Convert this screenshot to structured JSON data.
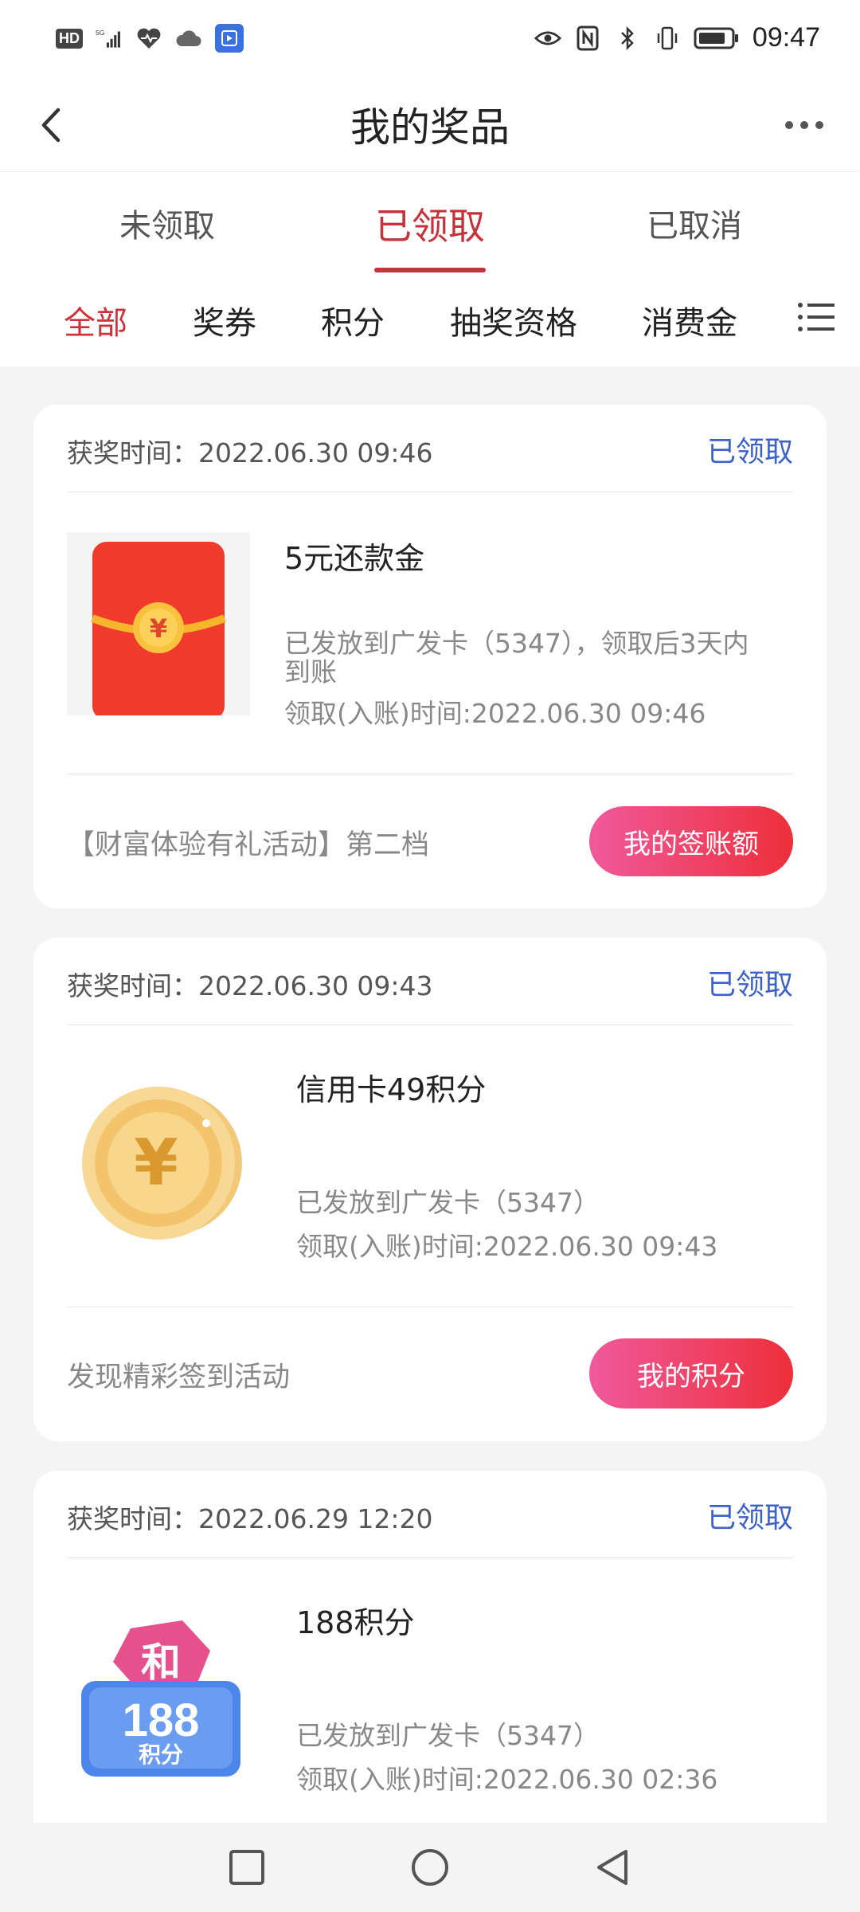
{
  "status_bar": {
    "time": "09:47",
    "left_icons": [
      "hd-icon",
      "5g-signal-icon",
      "health-icon",
      "cloud-icon",
      "app-notification-icon"
    ],
    "right_icons": [
      "eye-icon",
      "nfc-icon",
      "bluetooth-icon",
      "vibrate-icon",
      "battery-icon"
    ],
    "hd_label": "HD"
  },
  "header": {
    "title": "我的奖品"
  },
  "tabs": [
    {
      "label": "未领取",
      "active": false
    },
    {
      "label": "已领取",
      "active": true
    },
    {
      "label": "已取消",
      "active": false
    }
  ],
  "filters": [
    {
      "label": "全部",
      "active": true
    },
    {
      "label": "奖券",
      "active": false
    },
    {
      "label": "积分",
      "active": false
    },
    {
      "label": "抽奖资格",
      "active": false
    },
    {
      "label": "消费金",
      "active": false
    }
  ],
  "cards": [
    {
      "award_time": "获奖时间：2022.06.30 09:46",
      "status": "已领取",
      "prize_name": "5元还款金",
      "desc_line1": "已发放到广发卡（5347），领取后3天内",
      "desc_line2": "到账",
      "receive_time": "领取(入账)时间:2022.06.30 09:46",
      "activity": "【财富体验有礼活动】第二档",
      "button": "我的签账额",
      "image": "red-envelope-icon"
    },
    {
      "award_time": "获奖时间：2022.06.30 09:43",
      "status": "已领取",
      "prize_name": "信用卡49积分",
      "desc_line1": "已发放到广发卡（5347）",
      "receive_time": "领取(入账)时间:2022.06.30 09:43",
      "activity": "发现精彩签到活动",
      "button": "我的积分",
      "image": "gold-coin-icon"
    },
    {
      "award_time": "获奖时间：2022.06.29 12:20",
      "status": "已领取",
      "prize_name": "188积分",
      "desc_line1": "已发放到广发卡（5347）",
      "receive_time": "领取(入账)时间:2022.06.30 02:36",
      "image": "points-badge-icon",
      "badge_top": "和",
      "badge_number": "188",
      "badge_unit": "积分"
    }
  ],
  "colors": {
    "accent_red": "#c8313b",
    "link_blue": "#3c62c9",
    "pill_gradient_start": "#f0599c",
    "pill_gradient_end": "#ee2f3a"
  }
}
